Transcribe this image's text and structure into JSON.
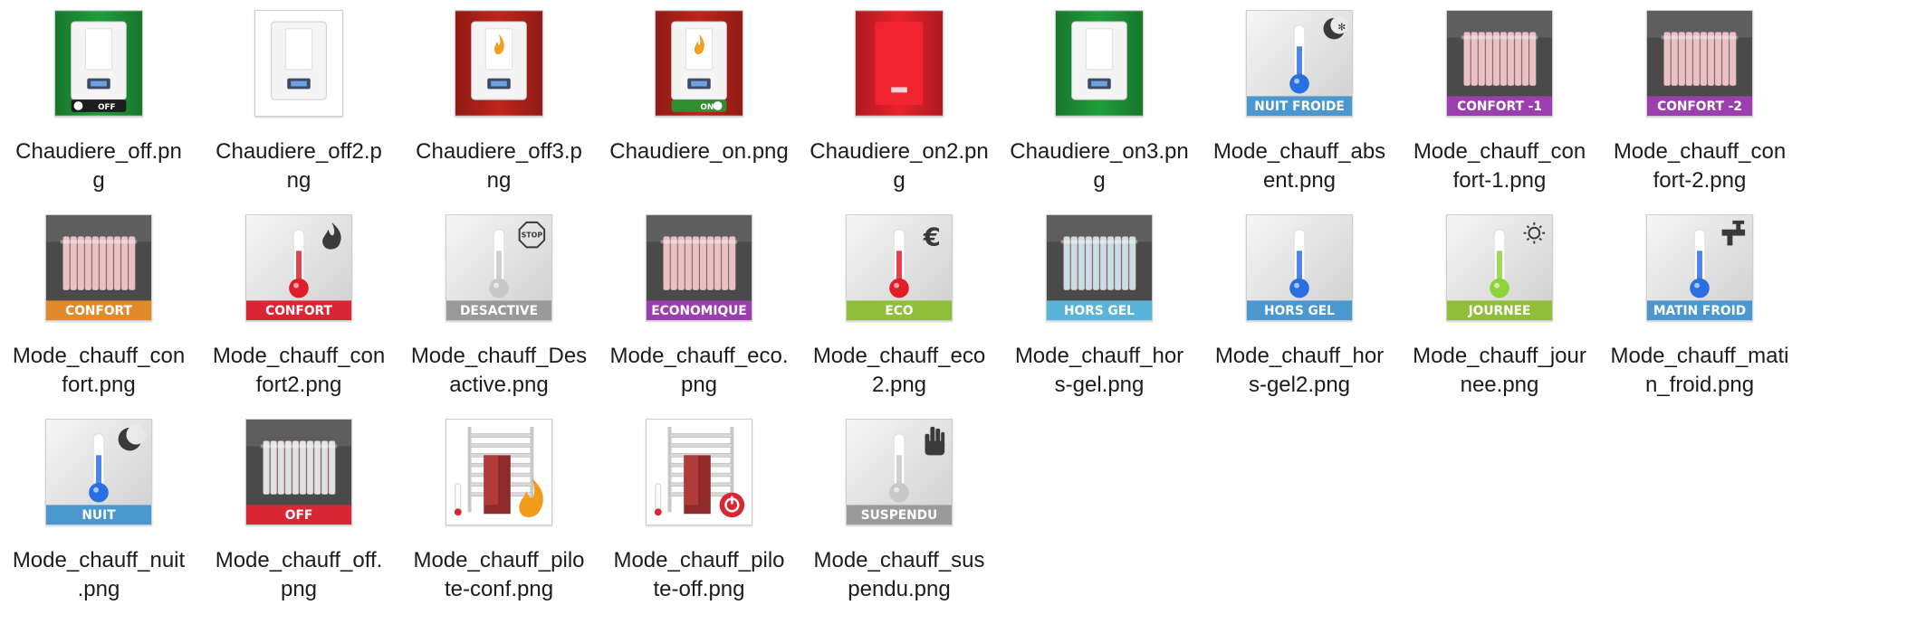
{
  "files": [
    {
      "id": "chaudiere_off",
      "lines": [
        "Chaudiere_off.pn",
        "g"
      ],
      "kind": "boiler",
      "bg": "#1f9e3b",
      "badge": "OFF",
      "badgeColor": "#1d1d1d"
    },
    {
      "id": "chaudiere_off2",
      "lines": [
        "Chaudiere_off2.p",
        "ng"
      ],
      "kind": "boiler",
      "bg": "#ffffff",
      "badge": "",
      "badgeColor": ""
    },
    {
      "id": "chaudiere_off3",
      "lines": [
        "Chaudiere_off3.p",
        "ng"
      ],
      "kind": "boiler",
      "bg": "#c0241c",
      "badge": "",
      "badgeColor": "",
      "flame": true
    },
    {
      "id": "chaudiere_on",
      "lines": [
        "Chaudiere_on.png"
      ],
      "kind": "boiler",
      "bg": "#c0241c",
      "badge": "ON",
      "badgeColor": "#2f8f2f",
      "flame": true
    },
    {
      "id": "chaudiere_on2",
      "lines": [
        "Chaudiere_on2.pn",
        "g"
      ],
      "kind": "boiler",
      "bg": "#e8222a",
      "badge": "",
      "badgeColor": ""
    },
    {
      "id": "chaudiere_on3",
      "lines": [
        "Chaudiere_on3.pn",
        "g"
      ],
      "kind": "boiler",
      "bg": "#1f9e3b",
      "badge": "",
      "badgeColor": ""
    },
    {
      "id": "mode_absent",
      "lines": [
        "Mode_chauff_abs",
        "ent.png"
      ],
      "kind": "thermo",
      "label": "NUIT FROIDE",
      "labelColor": "#4a98cf",
      "fluid": "#2a6fe0",
      "corner": "moon-snow-icon"
    },
    {
      "id": "mode_confort_1",
      "lines": [
        "Mode_chauff_con",
        "fort-1.png"
      ],
      "kind": "radiator",
      "label": "CONFORT -1",
      "labelColor": "#9b3eb0",
      "bg": "#4a4a4a",
      "rad": "#f2c8cc"
    },
    {
      "id": "mode_confort_2",
      "lines": [
        "Mode_chauff_con",
        "fort-2.png"
      ],
      "kind": "radiator",
      "label": "CONFORT -2",
      "labelColor": "#9b3eb0",
      "bg": "#4a4a4a",
      "rad": "#f2c8cc"
    },
    {
      "id": "mode_confort",
      "lines": [
        "Mode_chauff_con",
        "fort.png"
      ],
      "kind": "radiator",
      "label": "CONFORT",
      "labelColor": "#e08a2a",
      "bg": "#4a4a4a",
      "rad": "#f2c8cc"
    },
    {
      "id": "mode_confort2",
      "lines": [
        "Mode_chauff_con",
        "fort2.png"
      ],
      "kind": "thermo",
      "label": "CONFORT",
      "labelColor": "#d92634",
      "fluid": "#e01e2a",
      "corner": "flame-icon"
    },
    {
      "id": "mode_desactive",
      "lines": [
        "Mode_chauff_Des",
        "active.png"
      ],
      "kind": "thermo",
      "label": "DESACTIVE",
      "labelColor": "#9a9a9a",
      "fluid": "#c8c8c8",
      "corner": "stop-icon"
    },
    {
      "id": "mode_eco",
      "lines": [
        "Mode_chauff_eco.",
        "png"
      ],
      "kind": "radiator",
      "label": "ECONOMIQUE",
      "labelColor": "#9b3eb0",
      "bg": "#4a4a4a",
      "rad": "#f2c8cc"
    },
    {
      "id": "mode_eco2",
      "lines": [
        "Mode_chauff_eco",
        "2.png"
      ],
      "kind": "thermo",
      "label": "ECO",
      "labelColor": "#8fbf3a",
      "fluid": "#e01e2a",
      "corner": "euro-icon"
    },
    {
      "id": "mode_hors_gel",
      "lines": [
        "Mode_chauff_hor",
        "s-gel.png"
      ],
      "kind": "radiator",
      "label": "HORS GEL",
      "labelColor": "#5ab4d8",
      "bg": "#4a4a4a",
      "rad": "#cfe9ee"
    },
    {
      "id": "mode_hors_gel2",
      "lines": [
        "Mode_chauff_hor",
        "s-gel2.png"
      ],
      "kind": "thermo",
      "label": "HORS GEL",
      "labelColor": "#4a98cf",
      "fluid": "#2a6fe0",
      "corner": ""
    },
    {
      "id": "mode_journee",
      "lines": [
        "Mode_chauff_jour",
        "nee.png"
      ],
      "kind": "thermo",
      "label": "JOURNEE",
      "labelColor": "#8fbf3a",
      "fluid": "#8dd33a",
      "corner": "sun-icon"
    },
    {
      "id": "mode_matin_froid",
      "lines": [
        "Mode_chauff_mati",
        "n_froid.png"
      ],
      "kind": "thermo",
      "label": "MATIN FROID",
      "labelColor": "#4a98cf",
      "fluid": "#2a6fe0",
      "corner": "tap-icon"
    },
    {
      "id": "mode_nuit",
      "lines": [
        "Mode_chauff_nuit",
        ".png"
      ],
      "kind": "thermo",
      "label": "NUIT",
      "labelColor": "#4a98cf",
      "fluid": "#2a6fe0",
      "corner": "moon-icon"
    },
    {
      "id": "mode_off",
      "lines": [
        "Mode_chauff_off.",
        "png"
      ],
      "kind": "radiator",
      "label": "OFF",
      "labelColor": "#d92634",
      "bg": "#4a4a4a",
      "rad": "#e6ecec"
    },
    {
      "id": "mode_pilote_conf",
      "lines": [
        "Mode_chauff_pilo",
        "te-conf.png"
      ],
      "kind": "towel",
      "overlay": "flame-icon"
    },
    {
      "id": "mode_pilote_off",
      "lines": [
        "Mode_chauff_pilo",
        "te-off.png"
      ],
      "kind": "towel",
      "overlay": "power-icon"
    },
    {
      "id": "mode_suspendu",
      "lines": [
        "Mode_chauff_sus",
        "pendu.png"
      ],
      "kind": "thermo",
      "label": "SUSPENDU",
      "labelColor": "#9a9a9a",
      "fluid": "#c8c8c8",
      "corner": "hand-icon"
    }
  ]
}
